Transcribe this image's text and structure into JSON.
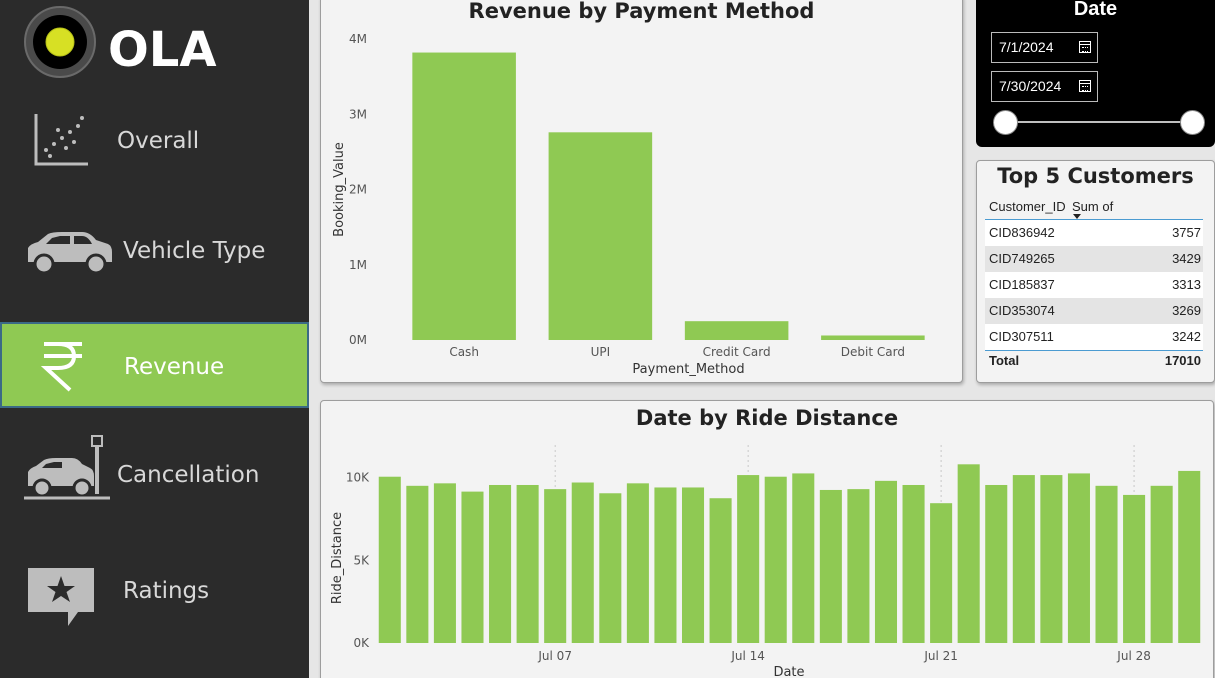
{
  "brand": {
    "logo_text": "OLA",
    "accent_color": "#8fc953",
    "sidebar_color": "#2b2b2b"
  },
  "sidebar": {
    "items": [
      {
        "label": "Overall",
        "icon": "scatter-chart-icon",
        "active": false
      },
      {
        "label": "Vehicle Type",
        "icon": "car-icon",
        "active": false
      },
      {
        "label": "Revenue",
        "icon": "rupee-icon",
        "active": true
      },
      {
        "label": "Cancellation",
        "icon": "car-crash-icon",
        "active": false
      },
      {
        "label": "Ratings",
        "icon": "star-review-icon",
        "active": false
      }
    ]
  },
  "date_slicer": {
    "title": "Date",
    "start": "7/1/2024",
    "end": "7/30/2024",
    "icon": "calendar-icon"
  },
  "top_customers": {
    "title": "Top 5 Customers",
    "columns": [
      "Customer_ID",
      "Sum of Booking_Value"
    ],
    "rows": [
      [
        "CID836942",
        "3757"
      ],
      [
        "CID749265",
        "3429"
      ],
      [
        "CID185837",
        "3313"
      ],
      [
        "CID353074",
        "3269"
      ],
      [
        "CID307511",
        "3242"
      ]
    ],
    "total_label": "Total",
    "total_value": "17010"
  },
  "chart_data": [
    {
      "type": "bar",
      "title": "Revenue by Payment Method",
      "xlabel": "Payment_Method",
      "ylabel": "Booking_Value",
      "categories": [
        "Cash",
        "UPI",
        "Credit Card",
        "Debit Card"
      ],
      "values": [
        3820000,
        2760000,
        250000,
        60000
      ],
      "ylim": [
        0,
        4000000
      ],
      "yticks": [
        0,
        1000000,
        2000000,
        3000000,
        4000000
      ],
      "ytick_labels": [
        "0M",
        "1M",
        "2M",
        "3M",
        "4M"
      ],
      "color": "#8fc953",
      "grid": false
    },
    {
      "type": "bar",
      "title": "Date by Ride Distance",
      "xlabel": "Date",
      "ylabel": "Ride_Distance",
      "x": [
        "2024-07-01",
        "2024-07-02",
        "2024-07-03",
        "2024-07-04",
        "2024-07-05",
        "2024-07-06",
        "2024-07-07",
        "2024-07-08",
        "2024-07-09",
        "2024-07-10",
        "2024-07-11",
        "2024-07-12",
        "2024-07-13",
        "2024-07-14",
        "2024-07-15",
        "2024-07-16",
        "2024-07-17",
        "2024-07-18",
        "2024-07-19",
        "2024-07-20",
        "2024-07-21",
        "2024-07-22",
        "2024-07-23",
        "2024-07-24",
        "2024-07-25",
        "2024-07-26",
        "2024-07-27",
        "2024-07-28",
        "2024-07-29",
        "2024-07-30"
      ],
      "values": [
        10050,
        9500,
        9650,
        9150,
        9550,
        9550,
        9300,
        9700,
        9050,
        9650,
        9400,
        9400,
        8750,
        10150,
        10050,
        10250,
        9250,
        9300,
        9800,
        9550,
        8450,
        10800,
        9550,
        10150,
        10150,
        10250,
        9500,
        8950,
        9500,
        10400
      ],
      "ylim": [
        0,
        11000
      ],
      "yticks": [
        0,
        5000,
        10000
      ],
      "ytick_labels": [
        "0K",
        "5K",
        "10K"
      ],
      "xtick_labels": [
        "Jul 07",
        "Jul 14",
        "Jul 21",
        "Jul 28"
      ],
      "xtick_positions": [
        "2024-07-07",
        "2024-07-14",
        "2024-07-21",
        "2024-07-28"
      ],
      "color": "#8fc953",
      "grid": false
    }
  ]
}
